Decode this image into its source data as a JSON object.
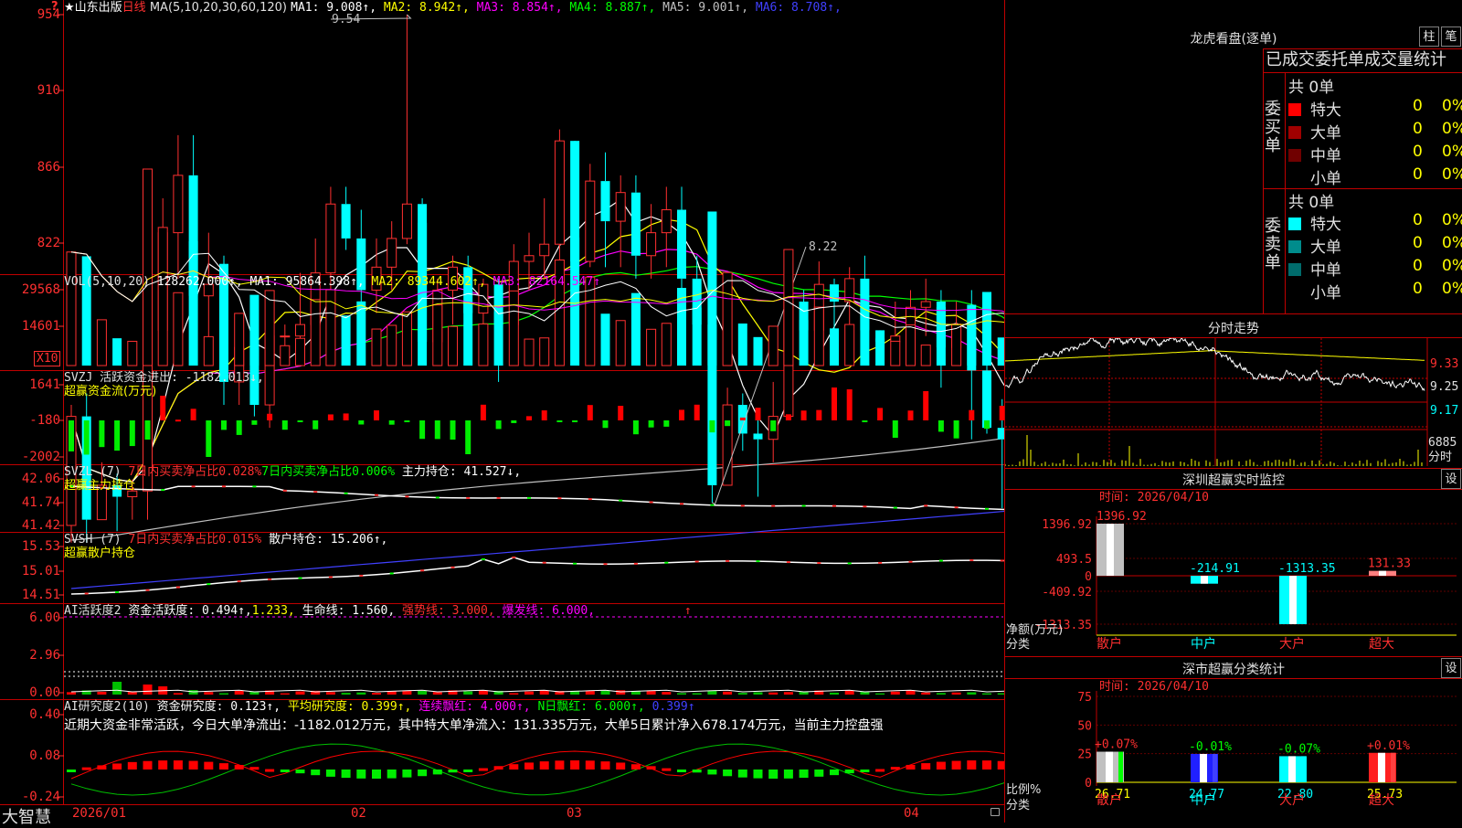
{
  "header": {
    "star": "★",
    "stock_name": "山东出版",
    "period": "日线",
    "ma_params": "MA(5,10,20,30,60,120)",
    "ma_values": [
      {
        "label": "MA1: 9.008↑",
        "color": "#ffffff"
      },
      {
        "label": "MA2: 8.942↑",
        "color": "#ffff00"
      },
      {
        "label": "MA3: 8.854↑",
        "color": "#ff00ff"
      },
      {
        "label": "MA4: 8.887↑",
        "color": "#00ff00"
      },
      {
        "label": "MA5: 9.001↑",
        "color": "#c0c0c0"
      },
      {
        "label": "MA6: 8.708↑",
        "color": "#4040ff"
      }
    ]
  },
  "kline": {
    "y_ticks": [
      "954",
      "910",
      "866",
      "822"
    ],
    "high_label": "9.54",
    "low_label": "8.22",
    "candles": [
      [
        8.65,
        8.84,
        8.62,
        8.86
      ],
      [
        8.84,
        8.66,
        8.62,
        8.88
      ],
      [
        8.66,
        8.72,
        8.66,
        8.76
      ],
      [
        8.72,
        8.7,
        8.64,
        8.74
      ],
      [
        8.7,
        8.71,
        8.66,
        8.73
      ],
      [
        8.71,
        8.99,
        8.66,
        9.2
      ],
      [
        8.99,
        9.16,
        8.94,
        9.22
      ],
      [
        9.16,
        9.26,
        9.08,
        9.33
      ],
      [
        9.26,
        9.05,
        9.0,
        9.33
      ],
      [
        9.05,
        9.07,
        8.96,
        9.16
      ],
      [
        9.07,
        8.9,
        8.86,
        9.12
      ],
      [
        8.9,
        8.96,
        8.86,
        8.98
      ],
      [
        8.96,
        8.86,
        8.84,
        9.0
      ],
      [
        8.86,
        8.98,
        8.82,
        9.06
      ],
      [
        8.98,
        8.98,
        8.94,
        9.0
      ],
      [
        8.98,
        9.0,
        8.97,
        9.09
      ],
      [
        9.0,
        9.09,
        8.96,
        9.15
      ],
      [
        9.09,
        9.21,
        9.03,
        9.24
      ],
      [
        9.21,
        9.15,
        9.13,
        9.24
      ],
      [
        9.15,
        9.06,
        9.02,
        9.2
      ],
      [
        9.06,
        9.1,
        9.02,
        9.15
      ],
      [
        9.1,
        9.15,
        9.06,
        9.18
      ],
      [
        9.15,
        9.21,
        9.14,
        9.54
      ],
      [
        9.21,
        8.97,
        8.95,
        9.22
      ],
      [
        8.97,
        9.06,
        9.0,
        9.08
      ],
      [
        9.06,
        9.1,
        9.0,
        9.12
      ],
      [
        9.1,
        9.02,
        8.94,
        9.12
      ],
      [
        9.02,
        9.07,
        8.96,
        9.08
      ],
      [
        9.07,
        9.0,
        8.9,
        9.08
      ],
      [
        9.0,
        9.11,
        8.96,
        9.14
      ],
      [
        9.11,
        9.12,
        9.06,
        9.16
      ],
      [
        9.12,
        9.14,
        9.08,
        9.22
      ],
      [
        9.14,
        9.32,
        9.06,
        9.34
      ],
      [
        9.32,
        9.11,
        9.03,
        9.28
      ],
      [
        9.11,
        9.25,
        9.1,
        9.28
      ],
      [
        9.25,
        9.18,
        9.1,
        9.3
      ],
      [
        9.18,
        9.23,
        9.1,
        9.26
      ],
      [
        9.23,
        9.12,
        9.08,
        9.26
      ],
      [
        9.12,
        9.16,
        9.08,
        9.21
      ],
      [
        9.16,
        9.2,
        9.1,
        9.24
      ],
      [
        9.2,
        9.08,
        9.05,
        9.24
      ],
      [
        9.08,
        9.0,
        8.98,
        9.12
      ],
      [
        9.0,
        8.72,
        8.69,
        9.03
      ],
      [
        8.72,
        8.86,
        8.79,
        8.89
      ],
      [
        8.86,
        8.81,
        8.78,
        8.88
      ],
      [
        8.81,
        8.8,
        8.7,
        8.84
      ],
      [
        8.8,
        8.84,
        8.76,
        8.9
      ],
      [
        8.84,
        9.04,
        8.88,
        9.11
      ],
      [
        9.04,
        8.99,
        8.96,
        9.06
      ],
      [
        8.99,
        9.07,
        8.94,
        9.11
      ],
      [
        9.07,
        9.04,
        8.98,
        9.08
      ],
      [
        9.04,
        9.08,
        8.94,
        9.1
      ],
      [
        9.08,
        8.99,
        8.94,
        9.12
      ],
      [
        8.99,
        8.97,
        8.96,
        8.98
      ],
      [
        8.97,
        8.98,
        8.94,
        9.04
      ],
      [
        8.98,
        9.03,
        8.98,
        9.06
      ],
      [
        9.03,
        9.04,
        8.98,
        9.08
      ],
      [
        9.04,
        8.96,
        8.89,
        9.06
      ],
      [
        8.96,
        9.0,
        8.96,
        9.04
      ],
      [
        9.0,
        8.92,
        8.8,
        9.06
      ],
      [
        8.92,
        8.82,
        8.81,
        8.99
      ],
      [
        8.82,
        8.8,
        8.68,
        8.87
      ],
      [
        8.8,
        8.76,
        8.7,
        8.84
      ],
      [
        8.76,
        8.81,
        8.76,
        8.9
      ],
      [
        8.81,
        8.99,
        8.81,
        9.0
      ],
      [
        8.99,
        9.1,
        8.98,
        9.1
      ],
      [
        9.1,
        9.07,
        9.0,
        9.12
      ],
      [
        9.07,
        9.03,
        8.96,
        9.1
      ],
      [
        9.03,
        9.0,
        8.94,
        9.11
      ],
      [
        9.0,
        9.03,
        8.98,
        9.06
      ]
    ]
  },
  "volume": {
    "label": "VOL(5,10,20)",
    "value": "128262.000↑,",
    "ma": [
      {
        "label": "MA1: 95864.398↑,",
        "color": "#ffffff"
      },
      {
        "label": "MA2: 89344.602↑,",
        "color": "#ffff00"
      },
      {
        "label": "MA3: 82164.547↑",
        "color": "#ff00ff"
      }
    ],
    "y_ticks": [
      "29568",
      "14601"
    ],
    "unit": "X10"
  },
  "svzj": {
    "line1": "SVZJ  活跃资金进出: -1182.013↓,",
    "line2": "超赢资金流(万元)",
    "y_ticks": [
      "1641",
      "-180",
      "-2002"
    ]
  },
  "svzl": {
    "name": "SVZL (7)",
    "t1": "7日内买卖净占比0.028%",
    "t2": "7日内买卖净占比0.006%",
    "t3": "主力持仓: 41.527↓,",
    "line2": "超赢主力持仓",
    "y_ticks": [
      "42.06",
      "41.74",
      "41.42"
    ]
  },
  "svsh": {
    "name": "SVSH (7)",
    "t1": "7日内买卖净占比0.015%",
    "t2": "散户持仓: 15.206↑,",
    "line2": "超赢散户持仓",
    "y_ticks": [
      "15.53",
      "15.01",
      "14.51"
    ]
  },
  "ai1": {
    "name": "AI活跃度2",
    "t1": "资金活跃度: 0.494↑,",
    "t2": "1.233,",
    "t3": "生命线: 1.560,",
    "t4": "强势线: 3.000,",
    "t5": "爆发线: 6.000,",
    "t6": "↑",
    "y_ticks": [
      "6.00",
      "2.96",
      "0.00"
    ]
  },
  "ai2": {
    "name": "AI研究度2(10)",
    "t1": "资金研究度: 0.123↑,",
    "t2": "平均研究度: 0.399↑,",
    "t3": "连续飘红: 4.000↑,",
    "t4": "N日飘红: 6.000↑,",
    "t5": "0.399↑",
    "comment": "近期大资金非常活跃，今日大单净流出：-1182.012万元，其中特大单净流入：131.335万元，大单5日累计净入678.174万元，当前主力控盘强",
    "y_ticks": [
      "0.40",
      "0.08",
      "-0.24"
    ]
  },
  "xaxis": {
    "labels": [
      "2026/01",
      "02",
      "03",
      "04"
    ]
  },
  "footer_brand": "大智慧",
  "lhb": {
    "title": "龙虎看盘(逐单)",
    "btn1": "柱",
    "btn2": "笔",
    "subtitle": "已成交委托单成交量统计",
    "buy": {
      "side_label": "委买单",
      "total": "共 0单",
      "rows": [
        {
          "name": "特大",
          "color": "#ff0000",
          "count": "0",
          "pct": "0%"
        },
        {
          "name": "大单",
          "color": "#a00000",
          "count": "0",
          "pct": "0%"
        },
        {
          "name": "中单",
          "color": "#700000",
          "count": "0",
          "pct": "0%"
        },
        {
          "name": "小单",
          "color": "#000000",
          "count": "0",
          "pct": "0%"
        }
      ]
    },
    "sell": {
      "side_label": "委卖单",
      "total": "共 0单",
      "rows": [
        {
          "name": "特大",
          "color": "#00ffff",
          "count": "0",
          "pct": "0%"
        },
        {
          "name": "大单",
          "color": "#008c8c",
          "count": "0",
          "pct": "0%"
        },
        {
          "name": "中单",
          "color": "#006c6c",
          "count": "0",
          "pct": "0%"
        },
        {
          "name": "小单",
          "color": "#000000",
          "count": "0",
          "pct": "0%"
        }
      ]
    }
  },
  "intraday": {
    "title": "分时走势",
    "y_ticks": [
      "9.33",
      "9.25",
      "9.17"
    ],
    "vol_label": "6885",
    "vol_unit": "分时"
  },
  "sz_monitor": {
    "title": "深圳超赢实时监控",
    "btn": "设",
    "time_label": "时间: 2026/04/10",
    "y_ticks": [
      "1396.92",
      "493.5",
      "0",
      "-409.92",
      "-1313.35"
    ],
    "ylabel1": "净额(万元)",
    "ylabel2": "分类",
    "categories": [
      "散户",
      "中户",
      "大户",
      "超大"
    ],
    "values": [
      1396.92,
      -214.91,
      -1313.35,
      131.33
    ],
    "value_labels": [
      "1396.92",
      "-214.91",
      "-1313.35",
      "131.33"
    ]
  },
  "sz_class": {
    "title": "深市超赢分类统计",
    "btn": "设",
    "time_label": "时间: 2026/04/10",
    "y_ticks": [
      "75",
      "50",
      "25",
      "0"
    ],
    "ylabel1": "比例%",
    "ylabel2": "分类",
    "categories": [
      "散户",
      "中户",
      "大户",
      "超大"
    ],
    "values": [
      26.71,
      24.77,
      22.8,
      25.73
    ],
    "changes": [
      "+0.07%",
      "-0.01%",
      "-0.07%",
      "+0.01%"
    ]
  }
}
